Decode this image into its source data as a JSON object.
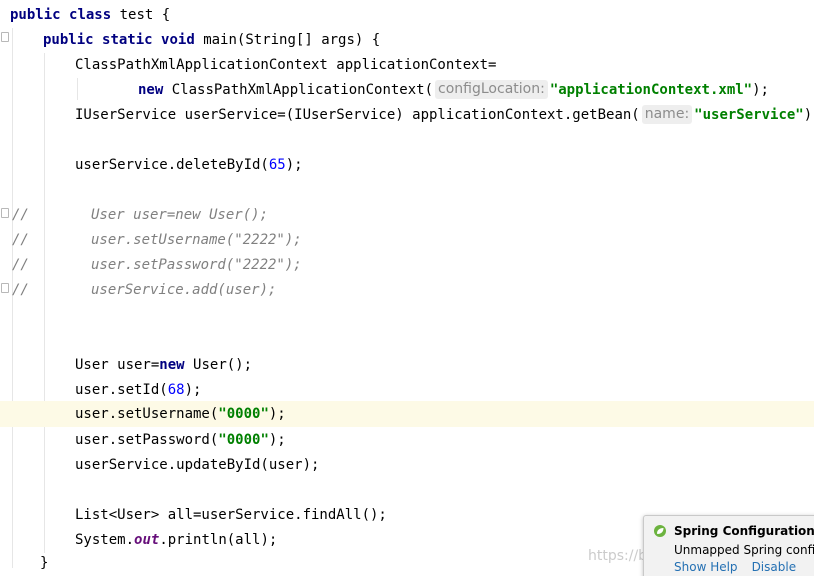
{
  "code": {
    "l1": {
      "kw1": "public",
      "kw2": "class",
      "name": "test {"
    },
    "l2": {
      "kw1": "public",
      "kw2": "static",
      "kw3": "void",
      "rest": "main(String[] args) {"
    },
    "l3": {
      "text": "ClassPathXmlApplicationContext applicationContext="
    },
    "l4": {
      "kw": "new",
      "call": "ClassPathXmlApplicationContext(",
      "hint": "configLocation:",
      "str": "\"applicationContext.xml\"",
      "end": ");"
    },
    "l5": {
      "text": "IUserService userService=(IUserService) applicationContext.getBean(",
      "hint": "name:",
      "str": "\"userService\"",
      "end": ");"
    },
    "l7": {
      "text": "userService.deleteById(",
      "num": "65",
      "end": ");"
    },
    "l9": {
      "prefix": "//",
      "text": "User user=new User();"
    },
    "l10": {
      "prefix": "//",
      "text": "user.setUsername(\"2222\");"
    },
    "l11": {
      "prefix": "//",
      "text": "user.setPassword(\"2222\");"
    },
    "l12": {
      "prefix": "//",
      "text": "userService.add(user);"
    },
    "l15": {
      "a": "User user=",
      "kw": "new",
      "b": "User();"
    },
    "l16": {
      "text": "user.setId(",
      "num": "68",
      "end": ");"
    },
    "l17": {
      "text": "user.setUsername(",
      "str": "\"0000\"",
      "end": ");"
    },
    "l18": {
      "text": "user.setPassword(",
      "str": "\"0000\"",
      "end": ");"
    },
    "l19": {
      "text": "userService.updateById(user);"
    },
    "l21": {
      "text": "List<User> all=userService.findAll();"
    },
    "l22": {
      "a": "System.",
      "field": "out",
      "b": ".println(all);"
    },
    "l23": {
      "text": "}"
    }
  },
  "notification": {
    "title": "Spring Configuration C",
    "body": "Unmapped Spring confi",
    "action_help": "Show Help",
    "action_disable": "Disable",
    "icon": "spring-leaf-icon"
  },
  "watermark": "https://blog.csdn.net/..."
}
